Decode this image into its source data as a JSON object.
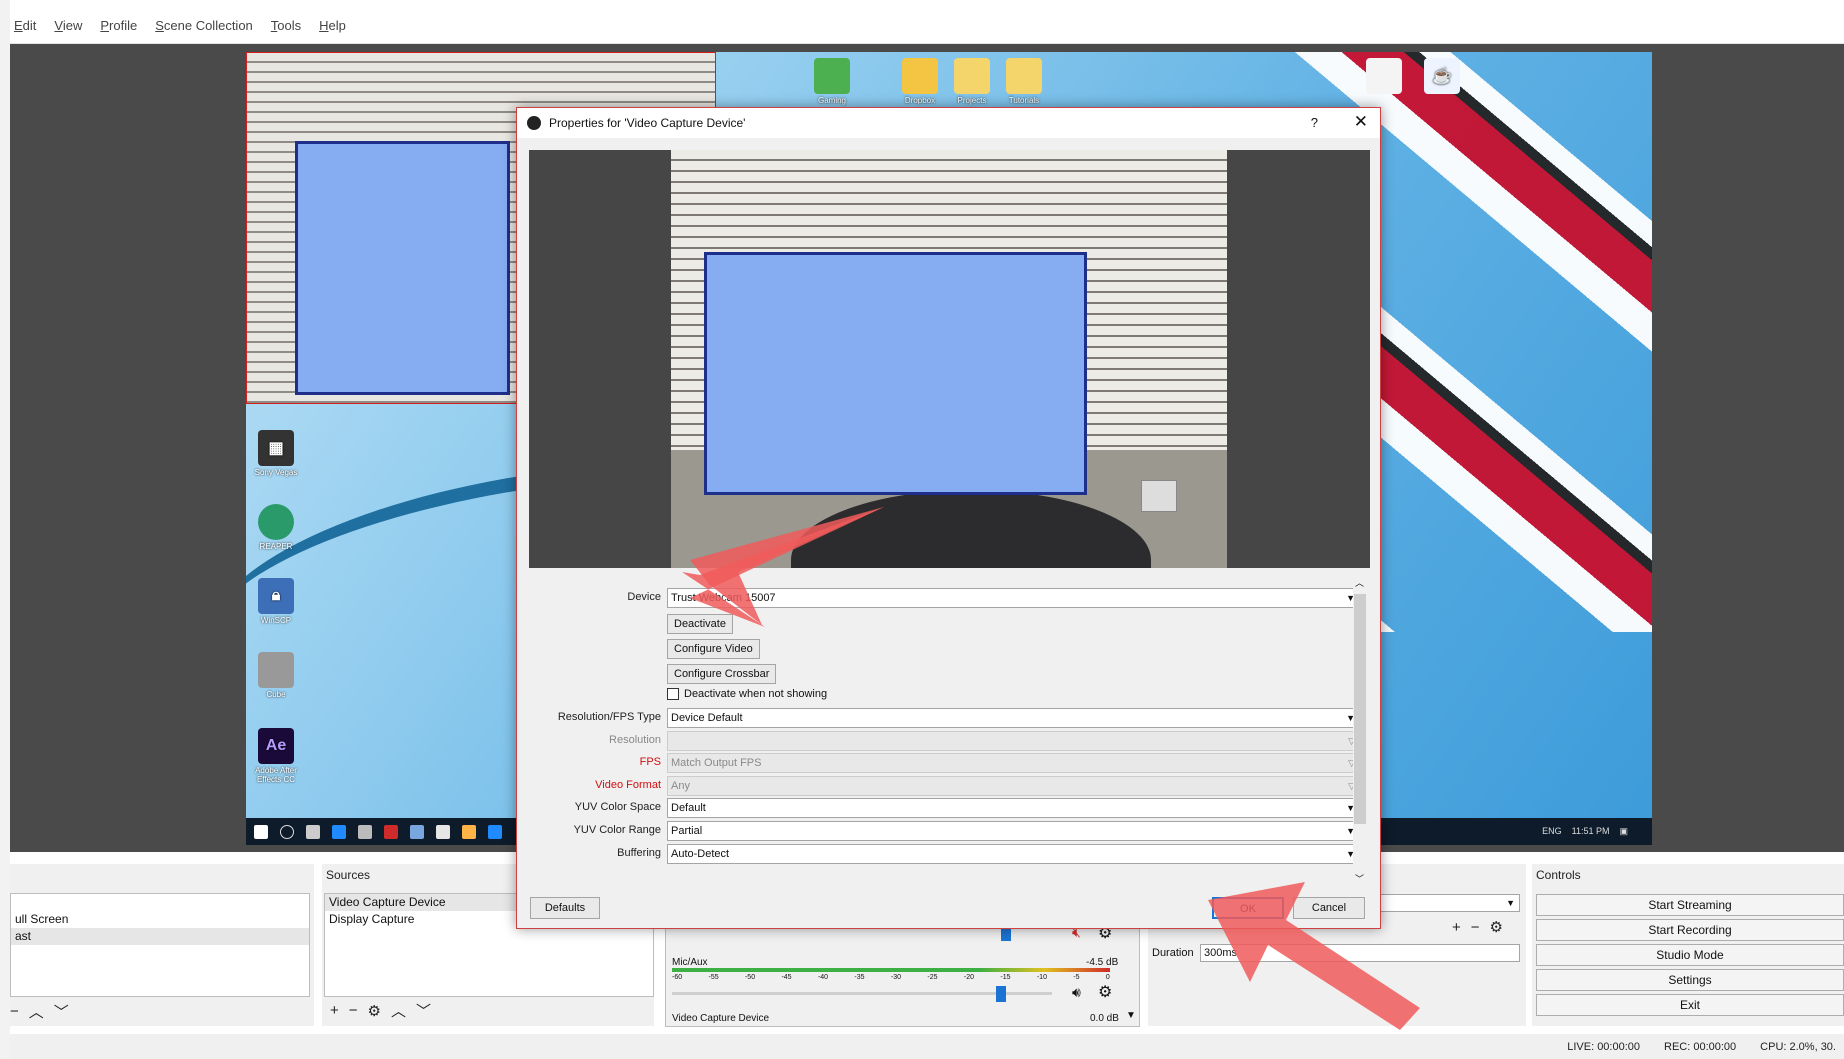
{
  "menu": [
    "Edit",
    "View",
    "Profile",
    "Scene Collection",
    "Tools",
    "Help"
  ],
  "desktop": {
    "icons_top": [
      "Gaming",
      "Dropbox",
      "Projects",
      "Tutorials"
    ],
    "icons_left": [
      "Sony Vegas",
      "REAPER",
      "WinSCP",
      "Cube",
      "Adobe After Effects CC"
    ],
    "taskbar_tray": [
      "ENG",
      "11:51 PM"
    ]
  },
  "dialog": {
    "title": "Properties for 'Video Capture Device'",
    "help": "?",
    "close": "✕",
    "props": {
      "device_label": "Device",
      "device_value": "Trust Webcam 15007",
      "deactivate": "Deactivate",
      "configure_video": "Configure Video",
      "configure_crossbar": "Configure Crossbar",
      "deactivate_when_hidden": "Deactivate when not showing",
      "res_type_label": "Resolution/FPS Type",
      "res_type_value": "Device Default",
      "resolution_label": "Resolution",
      "resolution_value": "",
      "fps_label": "FPS",
      "fps_value": "Match Output FPS",
      "video_format_label": "Video Format",
      "video_format_value": "Any",
      "yuv_space_label": "YUV Color Space",
      "yuv_space_value": "Default",
      "yuv_range_label": "YUV Color Range",
      "yuv_range_value": "Partial",
      "buffering_label": "Buffering",
      "buffering_value": "Auto-Detect"
    },
    "defaults": "Defaults",
    "ok": "OK",
    "cancel": "Cancel"
  },
  "scenes": {
    "items": [
      "",
      "ull Screen",
      "ast"
    ]
  },
  "sources": {
    "header": "Sources",
    "items": [
      "Video Capture Device",
      "Display Capture"
    ]
  },
  "mixer": {
    "mic_label": "Mic/Aux",
    "mic_db": "-4.5 dB",
    "vcd_label": "Video Capture Device",
    "vcd_db": "0.0 dB",
    "ticks": [
      "-60",
      "-55",
      "-50",
      "-45",
      "-40",
      "-35",
      "-30",
      "-25",
      "-20",
      "-15",
      "-10",
      "-5",
      "0"
    ]
  },
  "transitions": {
    "duration_label": "Duration",
    "duration_value": "300ms"
  },
  "controls": {
    "header": "Controls",
    "buttons": [
      "Start Streaming",
      "Start Recording",
      "Studio Mode",
      "Settings",
      "Exit"
    ]
  },
  "status": {
    "live": "LIVE: 00:00:00",
    "rec": "REC: 00:00:00",
    "cpu": "CPU: 2.0%, 30."
  },
  "colors": {
    "annotation_arrow": "#f05a5a",
    "selection_red": "#d21f1f",
    "blur_box": "#86acf2"
  }
}
